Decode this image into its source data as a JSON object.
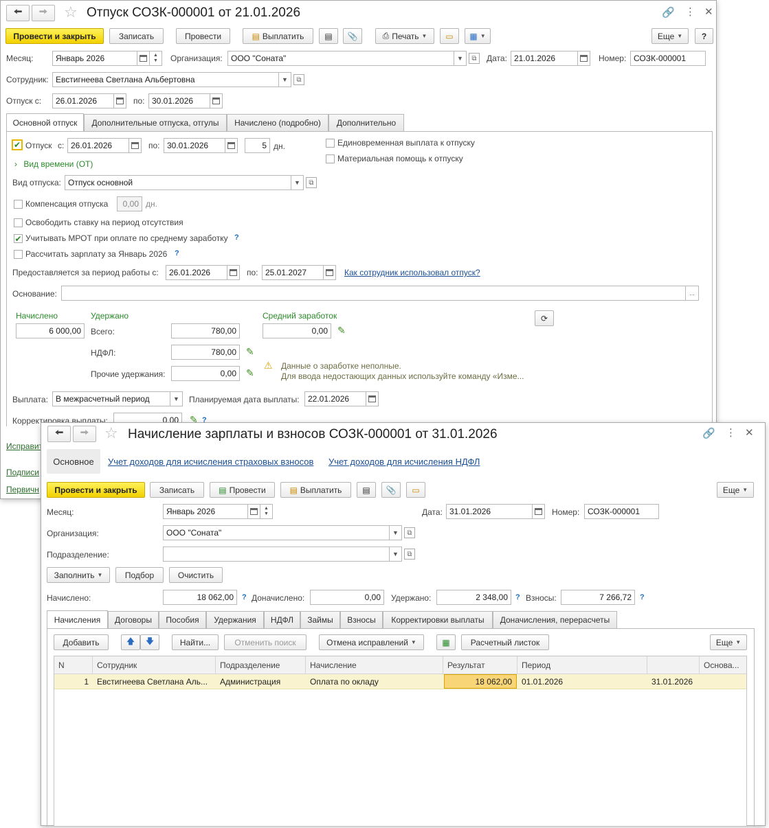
{
  "back": {
    "title": "Отпуск СОЗК-000001 от 21.01.2026",
    "toolbar": {
      "post_close": "Провести и закрыть",
      "save": "Записать",
      "post": "Провести",
      "pay": "Выплатить",
      "print": "Печать",
      "more": "Еще",
      "help": "?"
    },
    "month_label": "Месяц:",
    "month": "Январь 2026",
    "org_label": "Организация:",
    "org": "ООО \"Соната\"",
    "date_label": "Дата:",
    "date": "21.01.2026",
    "number_label": "Номер:",
    "number": "СОЗК-000001",
    "employee_label": "Сотрудник:",
    "employee": "Евстигнеева Светлана Альбертовна",
    "leave_from_label": "Отпуск с:",
    "leave_from": "26.01.2026",
    "leave_to_label": "по:",
    "leave_to": "30.01.2026",
    "tabs": [
      "Основной отпуск",
      "Дополнительные отпуска, отгулы",
      "Начислено (подробно)",
      "Дополнительно"
    ],
    "main": {
      "vacation_label": "Отпуск",
      "from_label": "с:",
      "from": "26.01.2026",
      "to_label": "по:",
      "to": "30.01.2026",
      "days": "5",
      "days_unit": "дн.",
      "one_time_payment": "Единовременная выплата к отпуску",
      "material_help": "Материальная помощь к отпуску",
      "time_type": "Вид времени (ОТ)",
      "vacation_type_label": "Вид отпуска:",
      "vacation_type": "Отпуск основной",
      "compensation_label": "Компенсация отпуска",
      "compensation_value": "0,00",
      "compensation_unit": "дн.",
      "release_rate": "Освободить ставку на период отсутствия",
      "mrot": "Учитывать МРОТ при оплате по среднему заработку",
      "calc_salary": "Рассчитать зарплату за Январь 2026",
      "period_label": "Предоставляется за период работы с:",
      "period_from": "26.01.2026",
      "period_to_label": "по:",
      "period_to": "25.01.2027",
      "period_link": "Как сотрудник использовал отпуск?",
      "basis_label": "Основание:",
      "basis": "",
      "basis_btn": "...",
      "accrued_label": "Начислено",
      "accrued": "6 000,00",
      "withheld_label": "Удержано",
      "total_label": "Всего:",
      "total": "780,00",
      "ndfl_label": "НДФЛ:",
      "ndfl": "780,00",
      "other_label": "Прочие удержания:",
      "other": "0,00",
      "avg_label": "Средний заработок",
      "avg": "0,00",
      "warn_line1": "Данные о заработке неполные.",
      "warn_line2": "Для ввода недостающих данных используйте команду «Изме...",
      "payout_label": "Выплата:",
      "payout": "В межрасчетный период",
      "plan_date_label": "Планируемая дата выплаты:",
      "plan_date": "22.01.2026",
      "correction_label": "Корректировка выплаты:",
      "correction": "0,00"
    },
    "bottom_links": [
      "Исправит",
      "Подписи",
      "Первичн"
    ]
  },
  "front": {
    "title": "Начисление зарплаты и взносов СОЗК-000001 от 31.01.2026",
    "nav": {
      "main": "Основное",
      "insurance": "Учет доходов для исчисления страховых взносов",
      "ndfl": "Учет доходов для исчисления НДФЛ"
    },
    "toolbar": {
      "post_close": "Провести и закрыть",
      "save": "Записать",
      "post": "Провести",
      "pay": "Выплатить",
      "more": "Еще"
    },
    "month_label": "Месяц:",
    "month": "Январь 2026",
    "date_label": "Дата:",
    "date": "31.01.2026",
    "number_label": "Номер:",
    "number": "СОЗК-000001",
    "org_label": "Организация:",
    "org": "ООО \"Соната\"",
    "dept_label": "Подразделение:",
    "dept": "",
    "actions": {
      "fill": "Заполнить",
      "select": "Подбор",
      "clear": "Очистить"
    },
    "accrued_label": "Начислено:",
    "accrued": "18 062,00",
    "extra_label": "Доначислено:",
    "extra": "0,00",
    "withheld_label": "Удержано:",
    "withheld": "2 348,00",
    "contrib_label": "Взносы:",
    "contrib": "7 266,72",
    "tabs": [
      "Начисления",
      "Договоры",
      "Пособия",
      "Удержания",
      "НДФЛ",
      "Займы",
      "Взносы",
      "Корректировки выплаты",
      "Доначисления, перерасчеты"
    ],
    "table_toolbar": {
      "add": "Добавить",
      "find": "Найти...",
      "cancel_search": "Отменить поиск",
      "cancel_fix": "Отмена исправлений",
      "payslip": "Расчетный листок",
      "more": "Еще"
    },
    "columns": [
      "N",
      "Сотрудник",
      "Подразделение",
      "Начисление",
      "Результат",
      "Период",
      "",
      "Основа..."
    ],
    "rows": [
      {
        "n": "1",
        "employee": "Евстигнеева Светлана Аль...",
        "dept": "Администрация",
        "accrual": "Оплата по окладу",
        "result": "18 062,00",
        "period_from": "01.01.2026",
        "period_to": "31.01.2026",
        "basis": ""
      }
    ]
  }
}
